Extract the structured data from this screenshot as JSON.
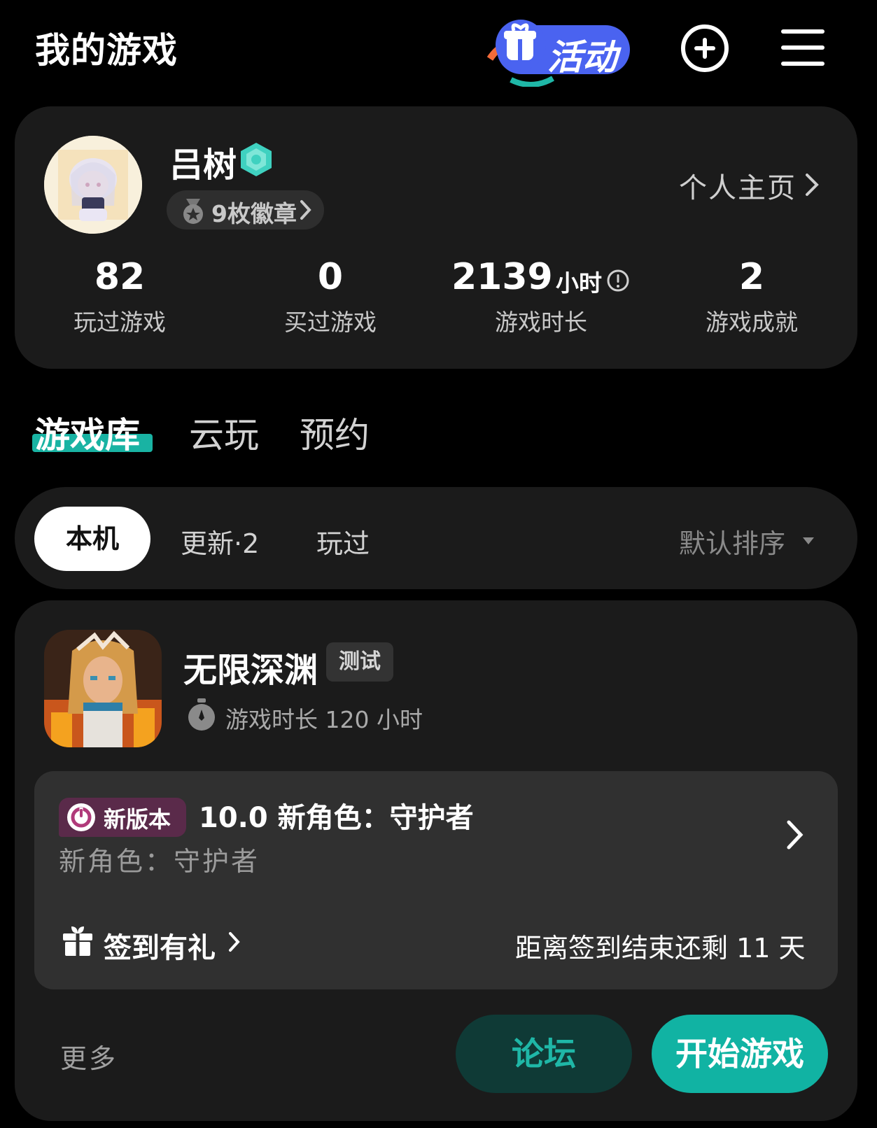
{
  "header": {
    "title": "我的游戏",
    "activity_label": "活动",
    "add_icon": "plus-circle-icon",
    "menu_icon": "hamburger-menu-icon"
  },
  "profile": {
    "username": "吕树",
    "badges_label": "9枚徽章",
    "homepage_label": "个人主页",
    "stats": {
      "played": {
        "value": "82",
        "label": "玩过游戏"
      },
      "bought": {
        "value": "0",
        "label": "买过游戏"
      },
      "hours": {
        "value": "2139",
        "unit": "小时",
        "label": "游戏时长"
      },
      "achievements": {
        "value": "2",
        "label": "游戏成就"
      }
    }
  },
  "tabs": {
    "library": "游戏库",
    "cloud": "云玩",
    "reserve": "预约"
  },
  "filters": {
    "local": "本机",
    "update": "更新·2",
    "played": "玩过",
    "sort": "默认排序"
  },
  "game": {
    "title": "无限深渊",
    "tag": "测试",
    "playtime": "游戏时长 120 小时",
    "news": {
      "tag": "新版本",
      "title": "10.0 新角色：守护者",
      "subtitle": "新角色：守护者"
    },
    "checkin": {
      "label": "签到有礼",
      "remaining": "距离签到结束还剩 11 天"
    },
    "more": "更多",
    "forum": "论坛",
    "start": "开始游戏"
  },
  "colors": {
    "accent": "#11b3a3",
    "card_bg": "#1b1b1b",
    "news_bg": "#303030",
    "activity_blue": "#4a63f0",
    "new_version_tag": "#5a2a4a"
  }
}
